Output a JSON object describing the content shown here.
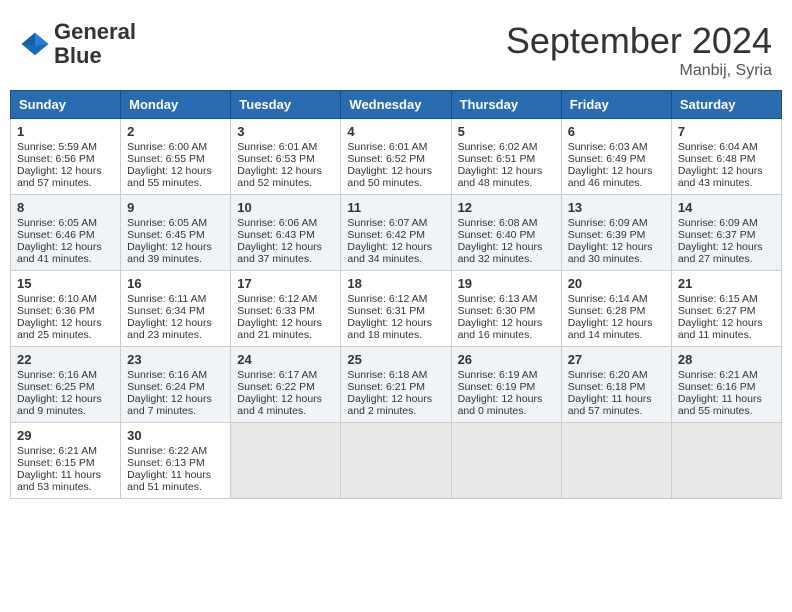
{
  "header": {
    "logo_line1": "General",
    "logo_line2": "Blue",
    "month_title": "September 2024",
    "location": "Manbij, Syria"
  },
  "days_of_week": [
    "Sunday",
    "Monday",
    "Tuesday",
    "Wednesday",
    "Thursday",
    "Friday",
    "Saturday"
  ],
  "weeks": [
    [
      {
        "day": "1",
        "info": "Sunrise: 5:59 AM\nSunset: 6:56 PM\nDaylight: 12 hours\nand 57 minutes."
      },
      {
        "day": "2",
        "info": "Sunrise: 6:00 AM\nSunset: 6:55 PM\nDaylight: 12 hours\nand 55 minutes."
      },
      {
        "day": "3",
        "info": "Sunrise: 6:01 AM\nSunset: 6:53 PM\nDaylight: 12 hours\nand 52 minutes."
      },
      {
        "day": "4",
        "info": "Sunrise: 6:01 AM\nSunset: 6:52 PM\nDaylight: 12 hours\nand 50 minutes."
      },
      {
        "day": "5",
        "info": "Sunrise: 6:02 AM\nSunset: 6:51 PM\nDaylight: 12 hours\nand 48 minutes."
      },
      {
        "day": "6",
        "info": "Sunrise: 6:03 AM\nSunset: 6:49 PM\nDaylight: 12 hours\nand 46 minutes."
      },
      {
        "day": "7",
        "info": "Sunrise: 6:04 AM\nSunset: 6:48 PM\nDaylight: 12 hours\nand 43 minutes."
      }
    ],
    [
      {
        "day": "8",
        "info": "Sunrise: 6:05 AM\nSunset: 6:46 PM\nDaylight: 12 hours\nand 41 minutes."
      },
      {
        "day": "9",
        "info": "Sunrise: 6:05 AM\nSunset: 6:45 PM\nDaylight: 12 hours\nand 39 minutes."
      },
      {
        "day": "10",
        "info": "Sunrise: 6:06 AM\nSunset: 6:43 PM\nDaylight: 12 hours\nand 37 minutes."
      },
      {
        "day": "11",
        "info": "Sunrise: 6:07 AM\nSunset: 6:42 PM\nDaylight: 12 hours\nand 34 minutes."
      },
      {
        "day": "12",
        "info": "Sunrise: 6:08 AM\nSunset: 6:40 PM\nDaylight: 12 hours\nand 32 minutes."
      },
      {
        "day": "13",
        "info": "Sunrise: 6:09 AM\nSunset: 6:39 PM\nDaylight: 12 hours\nand 30 minutes."
      },
      {
        "day": "14",
        "info": "Sunrise: 6:09 AM\nSunset: 6:37 PM\nDaylight: 12 hours\nand 27 minutes."
      }
    ],
    [
      {
        "day": "15",
        "info": "Sunrise: 6:10 AM\nSunset: 6:36 PM\nDaylight: 12 hours\nand 25 minutes."
      },
      {
        "day": "16",
        "info": "Sunrise: 6:11 AM\nSunset: 6:34 PM\nDaylight: 12 hours\nand 23 minutes."
      },
      {
        "day": "17",
        "info": "Sunrise: 6:12 AM\nSunset: 6:33 PM\nDaylight: 12 hours\nand 21 minutes."
      },
      {
        "day": "18",
        "info": "Sunrise: 6:12 AM\nSunset: 6:31 PM\nDaylight: 12 hours\nand 18 minutes."
      },
      {
        "day": "19",
        "info": "Sunrise: 6:13 AM\nSunset: 6:30 PM\nDaylight: 12 hours\nand 16 minutes."
      },
      {
        "day": "20",
        "info": "Sunrise: 6:14 AM\nSunset: 6:28 PM\nDaylight: 12 hours\nand 14 minutes."
      },
      {
        "day": "21",
        "info": "Sunrise: 6:15 AM\nSunset: 6:27 PM\nDaylight: 12 hours\nand 11 minutes."
      }
    ],
    [
      {
        "day": "22",
        "info": "Sunrise: 6:16 AM\nSunset: 6:25 PM\nDaylight: 12 hours\nand 9 minutes."
      },
      {
        "day": "23",
        "info": "Sunrise: 6:16 AM\nSunset: 6:24 PM\nDaylight: 12 hours\nand 7 minutes."
      },
      {
        "day": "24",
        "info": "Sunrise: 6:17 AM\nSunset: 6:22 PM\nDaylight: 12 hours\nand 4 minutes."
      },
      {
        "day": "25",
        "info": "Sunrise: 6:18 AM\nSunset: 6:21 PM\nDaylight: 12 hours\nand 2 minutes."
      },
      {
        "day": "26",
        "info": "Sunrise: 6:19 AM\nSunset: 6:19 PM\nDaylight: 12 hours\nand 0 minutes."
      },
      {
        "day": "27",
        "info": "Sunrise: 6:20 AM\nSunset: 6:18 PM\nDaylight: 11 hours\nand 57 minutes."
      },
      {
        "day": "28",
        "info": "Sunrise: 6:21 AM\nSunset: 6:16 PM\nDaylight: 11 hours\nand 55 minutes."
      }
    ],
    [
      {
        "day": "29",
        "info": "Sunrise: 6:21 AM\nSunset: 6:15 PM\nDaylight: 11 hours\nand 53 minutes."
      },
      {
        "day": "30",
        "info": "Sunrise: 6:22 AM\nSunset: 6:13 PM\nDaylight: 11 hours\nand 51 minutes."
      },
      {
        "day": "",
        "info": ""
      },
      {
        "day": "",
        "info": ""
      },
      {
        "day": "",
        "info": ""
      },
      {
        "day": "",
        "info": ""
      },
      {
        "day": "",
        "info": ""
      }
    ]
  ]
}
